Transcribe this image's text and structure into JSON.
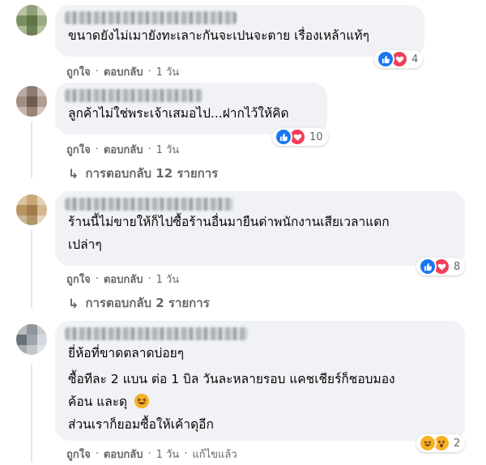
{
  "comments": [
    {
      "text_lines": [
        "ขนาดยังไม่เมายังทะเลาะกันจะเปนจะตาย เรื่องเหล้าแท้ๆ"
      ],
      "reaction_count": "4",
      "actions": {
        "like": "ถูกใจ",
        "reply": "ตอบกลับ",
        "time": "1 วัน",
        "edited": ""
      }
    },
    {
      "text_lines": [
        "ลูกค้าไม่ใช่พระเจ้าเสมอไป...ฝากไว้ให้คิด"
      ],
      "reaction_count": "10",
      "actions": {
        "like": "ถูกใจ",
        "reply": "ตอบกลับ",
        "time": "1 วัน",
        "edited": ""
      },
      "replies_label": "การตอบกลับ 12 รายการ"
    },
    {
      "text_lines": [
        "ร้านนี้ไม่ขายให้ก็ไปซื้อร้านอื่นมายืนด่าพนักงานเสียเวลาแดก",
        "เปล่าๆ"
      ],
      "reaction_count": "8",
      "actions": {
        "like": "ถูกใจ",
        "reply": "ตอบกลับ",
        "time": "1 วัน",
        "edited": ""
      },
      "replies_label": "การตอบกลับ 2 รายการ"
    },
    {
      "text_lines": [
        "ยี่ห้อที่ขาดตลาดบ่อยๆ",
        "ซื้อทีละ 2 แบน ต่อ 1 บิล วันละหลายรอบ แคชเชียร์ก็ชอบมอง",
        "ค้อน และดุ",
        "ส่วนเราก็ยอมซื้อให้เค้าดุอีก"
      ],
      "reaction_count": "2",
      "actions": {
        "like": "ถูกใจ",
        "reply": "ตอบกลับ",
        "time": "1 วัน",
        "edited": "แก้ไขแล้ว"
      }
    }
  ],
  "colors": {
    "bubble": "#f0f2f5",
    "meta_text": "#65676b",
    "like_blue": "#1877f2",
    "love_red": "#f33e58",
    "haha_yellow": "#f7b125"
  }
}
